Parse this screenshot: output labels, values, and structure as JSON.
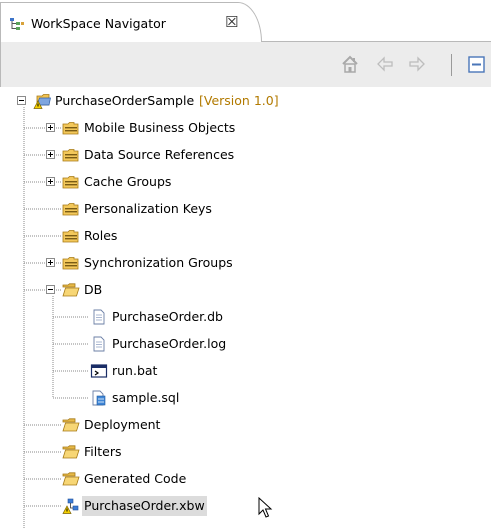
{
  "tab": {
    "title": "WorkSpace Navigator",
    "close_glyph": "☒",
    "icon": "navigator-icon"
  },
  "toolbar": {
    "buttons": [
      "home-icon",
      "back-arrow-icon",
      "forward-arrow-icon",
      "collapse-all-icon"
    ]
  },
  "tree": {
    "root": {
      "label": "PurchaseOrderSample",
      "version": "[Version 1.0]",
      "icon": "project-warning-icon"
    },
    "items": [
      {
        "label": "Mobile Business Objects",
        "icon": "folder-icon",
        "expander": "plus"
      },
      {
        "label": "Data Source References",
        "icon": "folder-icon",
        "expander": "plus"
      },
      {
        "label": "Cache Groups",
        "icon": "folder-icon",
        "expander": "plus"
      },
      {
        "label": "Personalization Keys",
        "icon": "folder-icon",
        "expander": "none"
      },
      {
        "label": "Roles",
        "icon": "folder-icon",
        "expander": "none"
      },
      {
        "label": "Synchronization Groups",
        "icon": "folder-icon",
        "expander": "plus"
      },
      {
        "label": "DB",
        "icon": "open-folder-icon",
        "expander": "minus",
        "children": [
          {
            "label": "PurchaseOrder.db",
            "icon": "file-icon"
          },
          {
            "label": "PurchaseOrder.log",
            "icon": "file-icon"
          },
          {
            "label": "run.bat",
            "icon": "batch-file-icon"
          },
          {
            "label": "sample.sql",
            "icon": "sql-file-icon"
          }
        ]
      },
      {
        "label": "Deployment",
        "icon": "open-folder-icon",
        "expander": "none"
      },
      {
        "label": "Filters",
        "icon": "open-folder-icon",
        "expander": "none"
      },
      {
        "label": "Generated Code",
        "icon": "open-folder-icon",
        "expander": "none"
      },
      {
        "label": "PurchaseOrder.xbw",
        "icon": "diagram-warning-icon",
        "expander": "none",
        "selected": true
      }
    ]
  },
  "colors": {
    "version_text": "#b27a00",
    "toolbar_bg": "#ececec",
    "selection_bg": "#dcdcdc"
  }
}
